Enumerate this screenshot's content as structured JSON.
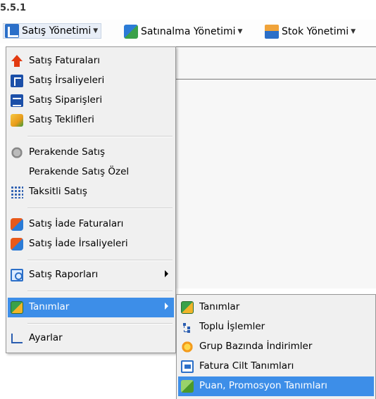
{
  "version": "5.5.1",
  "menubar": {
    "items": [
      {
        "label": "Satış Yönetimi",
        "icon": "sales-icon"
      },
      {
        "label": "Satınalma Yönetimi",
        "icon": "purchase-icon"
      },
      {
        "label": "Stok Yönetimi",
        "icon": "stock-icon"
      }
    ]
  },
  "sales_menu": {
    "items": [
      {
        "label": "Satış Faturaları",
        "icon": "red-up-arrow-icon"
      },
      {
        "label": "Satış İrsaliyeleri",
        "icon": "document-icon"
      },
      {
        "label": "Satış Siparişleri",
        "icon": "calendar-icon"
      },
      {
        "label": "Satış Teklifleri",
        "icon": "box-icon"
      },
      {
        "label": "Perakende Satış",
        "icon": "pos-icon"
      },
      {
        "label": "Perakende Satış Özel",
        "icon": ""
      },
      {
        "label": "Taksitli Satış",
        "icon": "dots-grid-icon"
      },
      {
        "label": "Satış İade Faturaları",
        "icon": "return-icon"
      },
      {
        "label": "Satış İade İrsaliyeleri",
        "icon": "return-icon"
      },
      {
        "label": "Satış Raporları",
        "icon": "report-icon",
        "has_submenu": true
      },
      {
        "label": "Tanımlar",
        "icon": "definitions-icon",
        "has_submenu": true,
        "highlighted": true
      },
      {
        "label": "Ayarlar",
        "icon": "settings-icon"
      }
    ]
  },
  "definitions_submenu": {
    "items": [
      {
        "label": "Tanımlar",
        "icon": "definitions-icon"
      },
      {
        "label": "Toplu İşlemler",
        "icon": "tree-icon"
      },
      {
        "label": "Grup Bazında İndirimler",
        "icon": "burst-icon"
      },
      {
        "label": "Fatura Cilt Tanımları",
        "icon": "card-icon"
      },
      {
        "label": "Puan, Promosyon Tanımları",
        "icon": "promotion-icon",
        "highlighted": true
      }
    ]
  },
  "colors": {
    "highlight": "#3d8ee8",
    "menu_bg": "#f0f0f0"
  }
}
